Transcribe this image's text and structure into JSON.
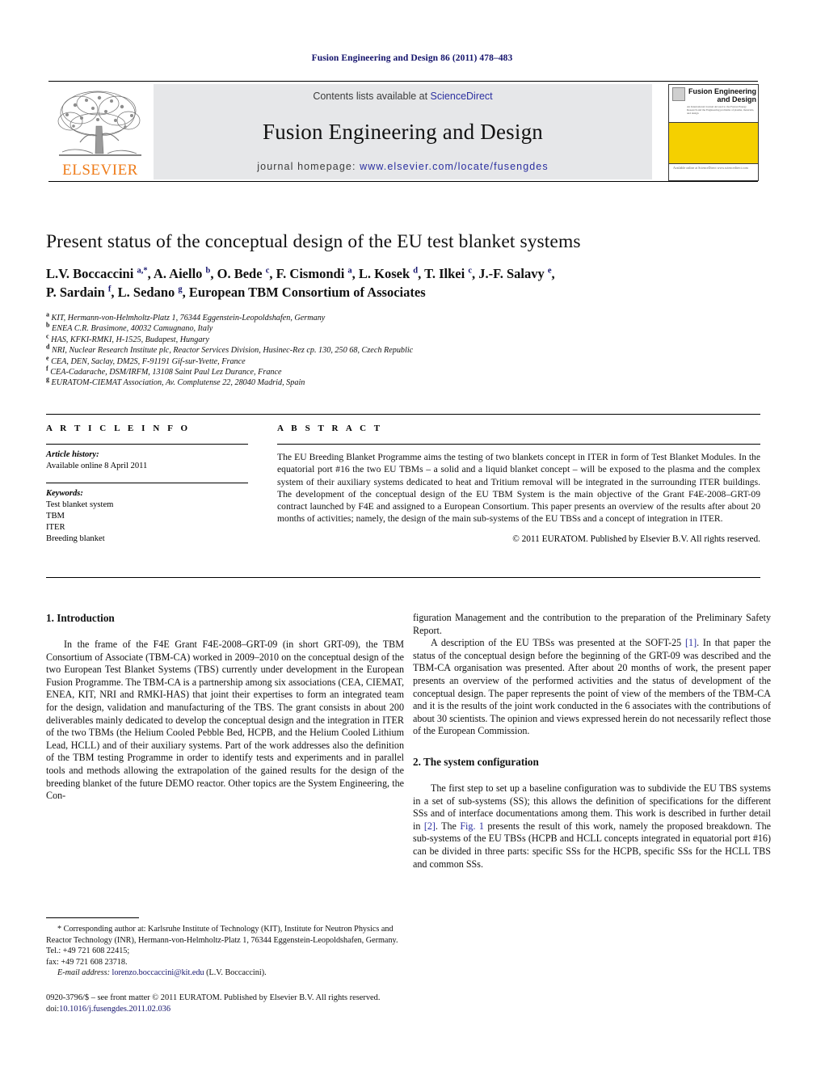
{
  "running_head": "Fusion Engineering and Design 86 (2011) 478–483",
  "header": {
    "contents_prefix": "Contents lists available at ",
    "sciencedirect": "ScienceDirect",
    "journal_title": "Fusion Engineering and Design",
    "homepage_prefix": "journal homepage:",
    "homepage_url": "www.elsevier.com/locate/fusengdes",
    "publisher_logo_text": "ELSEVIER",
    "cover": {
      "name_line1": "Fusion Engineering",
      "name_line2": "and Design",
      "sub_text": "An International Journal devoted to the Fusion Energy Research and the Engineering problems of plasma, materials, and design",
      "bottom_text": "Available online at\nScienceDirect\nwww.sciencedirect.com",
      "accent_color": "#f5d000"
    },
    "link_color": "#2b2fa0"
  },
  "article": {
    "title": "Present status of the conceptual design of the EU test blanket systems",
    "authors_line1": "L.V. Boccaccini <sup>a,*</sup>, A. Aiello <sup>b</sup>, O. Bede <sup>c</sup>, F. Cismondi <sup>a</sup>, L. Kosek <sup>d</sup>, T. Ilkei <sup>c</sup>, J.-F. Salavy <sup>e</sup>,",
    "authors_line2": "P. Sardain <sup>f</sup>, L. Sedano <sup>g</sup>, European TBM Consortium of Associates",
    "affiliations": [
      {
        "mark": "a",
        "text": "KIT, Hermann-von-Helmholtz-Platz 1, 76344 Eggenstein-Leopoldshafen, Germany"
      },
      {
        "mark": "b",
        "text": "ENEA C.R. Brasimone, 40032 Camugnano, Italy"
      },
      {
        "mark": "c",
        "text": "HAS, KFKI-RMKI, H-1525, Budapest, Hungary"
      },
      {
        "mark": "d",
        "text": "NRI, Nuclear Research Institute plc, Reactor Services Division, Husinec-Rez cp. 130, 250 68, Czech Republic"
      },
      {
        "mark": "e",
        "text": "CEA, DEN, Saclay, DM2S, F-91191 Gif-sur-Yvette, France"
      },
      {
        "mark": "f",
        "text": "CEA-Cadarache, DSM/IRFM, 13108 Saint Paul Lez Durance, France"
      },
      {
        "mark": "g",
        "text": "EURATOM-CIEMAT Association, Av. Complutense 22, 28040 Madrid, Spain"
      }
    ]
  },
  "article_info": {
    "heading": "A R T I C L E    I N F O",
    "history_label": "Article history:",
    "history_value": "Available online 8 April 2011",
    "keywords_label": "Keywords:",
    "keywords": [
      "Test blanket system",
      "TBM",
      "ITER",
      "Breeding blanket"
    ]
  },
  "abstract": {
    "heading": "A B S T R A C T",
    "text": "The EU Breeding Blanket Programme aims the testing of two blankets concept in ITER in form of Test Blanket Modules. In the equatorial port #16 the two EU TBMs – a solid and a liquid blanket concept – will be exposed to the plasma and the complex system of their auxiliary systems dedicated to heat and Tritium removal will be integrated in the surrounding ITER buildings. The development of the conceptual design of the EU TBM System is the main objective of the Grant F4E-2008–GRT-09 contract launched by F4E and assigned to a European Consortium. This paper presents an overview of the results after about 20 months of activities; namely, the design of the main sub-systems of the EU TBSs and a concept of integration in ITER.",
    "copyright": "© 2011 EURATOM. Published by Elsevier B.V. All rights reserved."
  },
  "body": {
    "section1_heading": "1.  Introduction",
    "section1_p1": "In the frame of the F4E Grant F4E-2008–GRT-09 (in short GRT-09), the TBM Consortium of Associate (TBM-CA) worked in 2009–2010 on the conceptual design of the two European Test Blanket Systems (TBS) currently under development in the European Fusion Programme. The TBM-CA is a partnership among six associations (CEA, CIEMAT, ENEA, KIT, NRI and RMKI-HAS) that joint their expertises to form an integrated team for the design, validation and manufacturing of the TBS. The grant consists in about 200 deliverables mainly dedicated to develop the conceptual design and the integration in ITER of the two TBMs (the Helium Cooled Pebble Bed, HCPB, and the Helium Cooled Lithium Lead, HCLL) and of their auxiliary systems. Part of the work addresses also the definition of the TBM testing Programme in order to identify tests and experiments and in parallel tools and methods allowing the extrapolation of the gained results for the design of the breeding blanket of the future DEMO reactor. Other topics are the System Engineering, the Configuration Management and the contribution to the preparation of the Preliminary Safety Report.",
    "section1_p2_a": "A description of the EU TBSs was presented at the SOFT-25 ",
    "section1_p2_ref": "[1]",
    "section1_p2_b": ". In that paper the status of the conceptual design before the beginning of the GRT-09 was described and the TBM-CA organisation was presented. After about 20 months of work, the present paper presents an overview of the performed activities and the status of development of the conceptual design. The paper represents the point of view of the members of the TBM-CA and it is the results of the joint work conducted in the 6 associates with the contributions of about 30 scientists. The opinion and views expressed herein do not necessarily reflect those of the European Commission.",
    "section2_heading": "2.  The system configuration",
    "section2_p1_a": "The first step to set up a baseline configuration was to subdivide the EU TBS systems in a set of sub-systems (SS); this allows the definition of specifications for the different SSs and of interface documentations among them. This work is described in further detail in ",
    "section2_p1_ref1": "[2]",
    "section2_p1_b": ". The ",
    "section2_p1_ref2": "Fig. 1",
    "section2_p1_c": " presents the result of this work, namely the proposed breakdown. The sub-systems of the EU TBSs (HCPB and HCLL concepts integrated in equatorial port #16) can be divided in three parts: specific SSs for the HCPB, specific SSs for the HCLL TBS and common SSs."
  },
  "footnotes": {
    "corresponding": "* Corresponding author at: Karlsruhe Institute of Technology (KIT), Institute for Neutron Physics and Reactor Technology (INR), Hermann-von-Helmholtz-Platz 1, 76344 Eggenstein-Leopoldshafen, Germany. Tel.: +49 721 608 22415;",
    "fax": "fax: +49 721 608 23718.",
    "email_label": "E-mail address:",
    "email": "lorenzo.boccaccini@kit.edu",
    "email_owner": "(L.V. Boccaccini).",
    "issn_line": "0920-3796/$ – see front matter © 2011 EURATOM. Published by Elsevier B.V. All rights reserved.",
    "doi_prefix": "doi:",
    "doi": "10.1016/j.fusengdes.2011.02.036"
  }
}
